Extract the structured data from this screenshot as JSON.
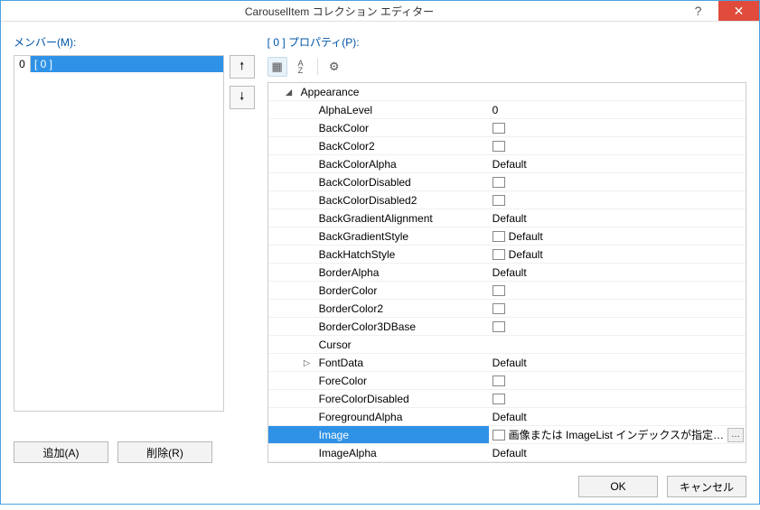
{
  "title": "CarouselItem コレクション エディター",
  "section_members": "メンバー(M):",
  "section_properties_prefix": "[ 0 ]",
  "section_properties": "プロパティ(P):",
  "member": {
    "index": "0",
    "label": "[ 0 ]"
  },
  "buttons": {
    "add": "追加(A)",
    "remove": "削除(R)",
    "ok": "OK",
    "cancel": "キャンセル"
  },
  "toolbar": {
    "categorized": "⊞",
    "sort": "A↓",
    "properties": "⚙"
  },
  "category": "Appearance",
  "props": [
    {
      "k": "AlphaLevel",
      "v": "0"
    },
    {
      "k": "BackColor",
      "swatch": true
    },
    {
      "k": "BackColor2",
      "swatch": true
    },
    {
      "k": "BackColorAlpha",
      "v": "Default"
    },
    {
      "k": "BackColorDisabled",
      "swatch": true
    },
    {
      "k": "BackColorDisabled2",
      "swatch": true
    },
    {
      "k": "BackGradientAlignment",
      "v": "Default"
    },
    {
      "k": "BackGradientStyle",
      "swatch": true,
      "v": "Default"
    },
    {
      "k": "BackHatchStyle",
      "swatch": true,
      "v": "Default"
    },
    {
      "k": "BorderAlpha",
      "v": "Default"
    },
    {
      "k": "BorderColor",
      "swatch": true
    },
    {
      "k": "BorderColor2",
      "swatch": true
    },
    {
      "k": "BorderColor3DBase",
      "swatch": true
    },
    {
      "k": "Cursor",
      "v": ""
    },
    {
      "k": "FontData",
      "v": "Default",
      "expander": true
    },
    {
      "k": "ForeColor",
      "swatch": true
    },
    {
      "k": "ForeColorDisabled",
      "swatch": true
    },
    {
      "k": "ForegroundAlpha",
      "v": "Default"
    },
    {
      "k": "Image",
      "swatch": true,
      "v": "画像または ImageList インデックスが指定…",
      "selected": true,
      "ellipsis": true
    },
    {
      "k": "ImageAlpha",
      "v": "Default"
    }
  ]
}
